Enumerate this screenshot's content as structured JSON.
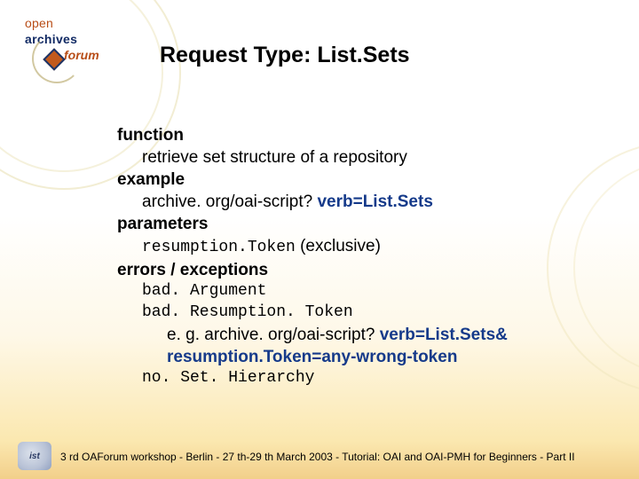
{
  "logo": {
    "line1a": "open",
    "line1b": "archives",
    "line2": "forum"
  },
  "title": "Request Type: List.Sets",
  "sections": {
    "function_label": "function",
    "function_text": "retrieve set structure of a repository",
    "example_label": "example",
    "example_prefix": "archive. org/oai-script? ",
    "example_verb": "verb=List.Sets",
    "parameters_label": "parameters",
    "parameters_token": "resumption.Token",
    "parameters_suffix": " (exclusive)",
    "errors_label": "errors / exceptions",
    "err_bad_arg": "bad. Argument",
    "err_bad_token": "bad. Resumption. Token",
    "err_eg_prefix": "e. g. archive. org/oai-script? ",
    "err_eg_blue1": "verb=List.Sets&",
    "err_eg_blue2": "resumption.Token=any-wrong-token",
    "err_nosh": "no. Set. Hierarchy"
  },
  "footer": {
    "badge": "ist",
    "text": "3 rd OAForum workshop - Berlin - 27 th-29 th March 2003 - Tutorial: OAI and OAI-PMH for Beginners - Part II"
  }
}
